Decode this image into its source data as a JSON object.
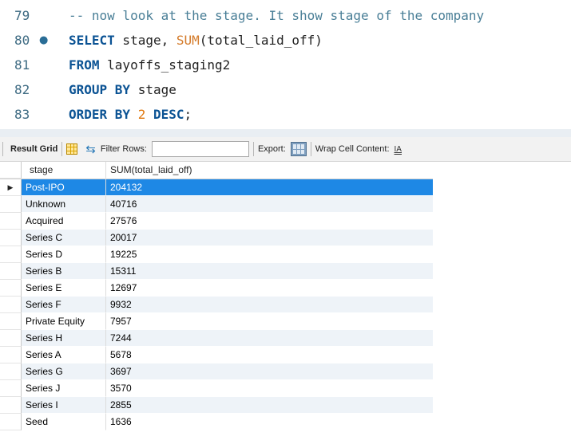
{
  "editor": {
    "lines": [
      {
        "num": "79",
        "marker": "",
        "text": "-- now look at the stage. It show stage of the company"
      },
      {
        "num": "80",
        "marker": "●",
        "t1": "SELECT",
        "t2": " stage, ",
        "t3": "SUM",
        "t4": "(total_laid_off)"
      },
      {
        "num": "81",
        "marker": "",
        "t1": "FROM",
        "t2": " layoffs_staging2"
      },
      {
        "num": "82",
        "marker": "",
        "t1": "GROUP BY",
        "t2": " stage"
      },
      {
        "num": "83",
        "marker": "",
        "t1": "ORDER BY",
        "t2": " ",
        "t3": "2",
        "t4": " ",
        "t5": "DESC",
        "t6": ";"
      }
    ]
  },
  "toolbar": {
    "result_grid_label": "Result Grid",
    "filter_rows_label": "Filter Rows:",
    "filter_value": "",
    "export_label": "Export:",
    "wrap_label": "Wrap Cell Content:",
    "wrap_icon_text": "IA"
  },
  "grid": {
    "columns": [
      "stage",
      "SUM(total_laid_off)"
    ],
    "rows": [
      [
        "Post-IPO",
        "204132"
      ],
      [
        "Unknown",
        "40716"
      ],
      [
        "Acquired",
        "27576"
      ],
      [
        "Series C",
        "20017"
      ],
      [
        "Series D",
        "19225"
      ],
      [
        "Series B",
        "15311"
      ],
      [
        "Series E",
        "12697"
      ],
      [
        "Series F",
        "9932"
      ],
      [
        "Private Equity",
        "7957"
      ],
      [
        "Series H",
        "7244"
      ],
      [
        "Series A",
        "5678"
      ],
      [
        "Series G",
        "3697"
      ],
      [
        "Series J",
        "3570"
      ],
      [
        "Series I",
        "2855"
      ],
      [
        "Seed",
        "1636"
      ]
    ],
    "selected_row_index": 0,
    "selected_indicator": "▶"
  },
  "colors": {
    "keyword": "#0b5394",
    "function": "#d47b2a",
    "selection": "#1e88e5"
  }
}
